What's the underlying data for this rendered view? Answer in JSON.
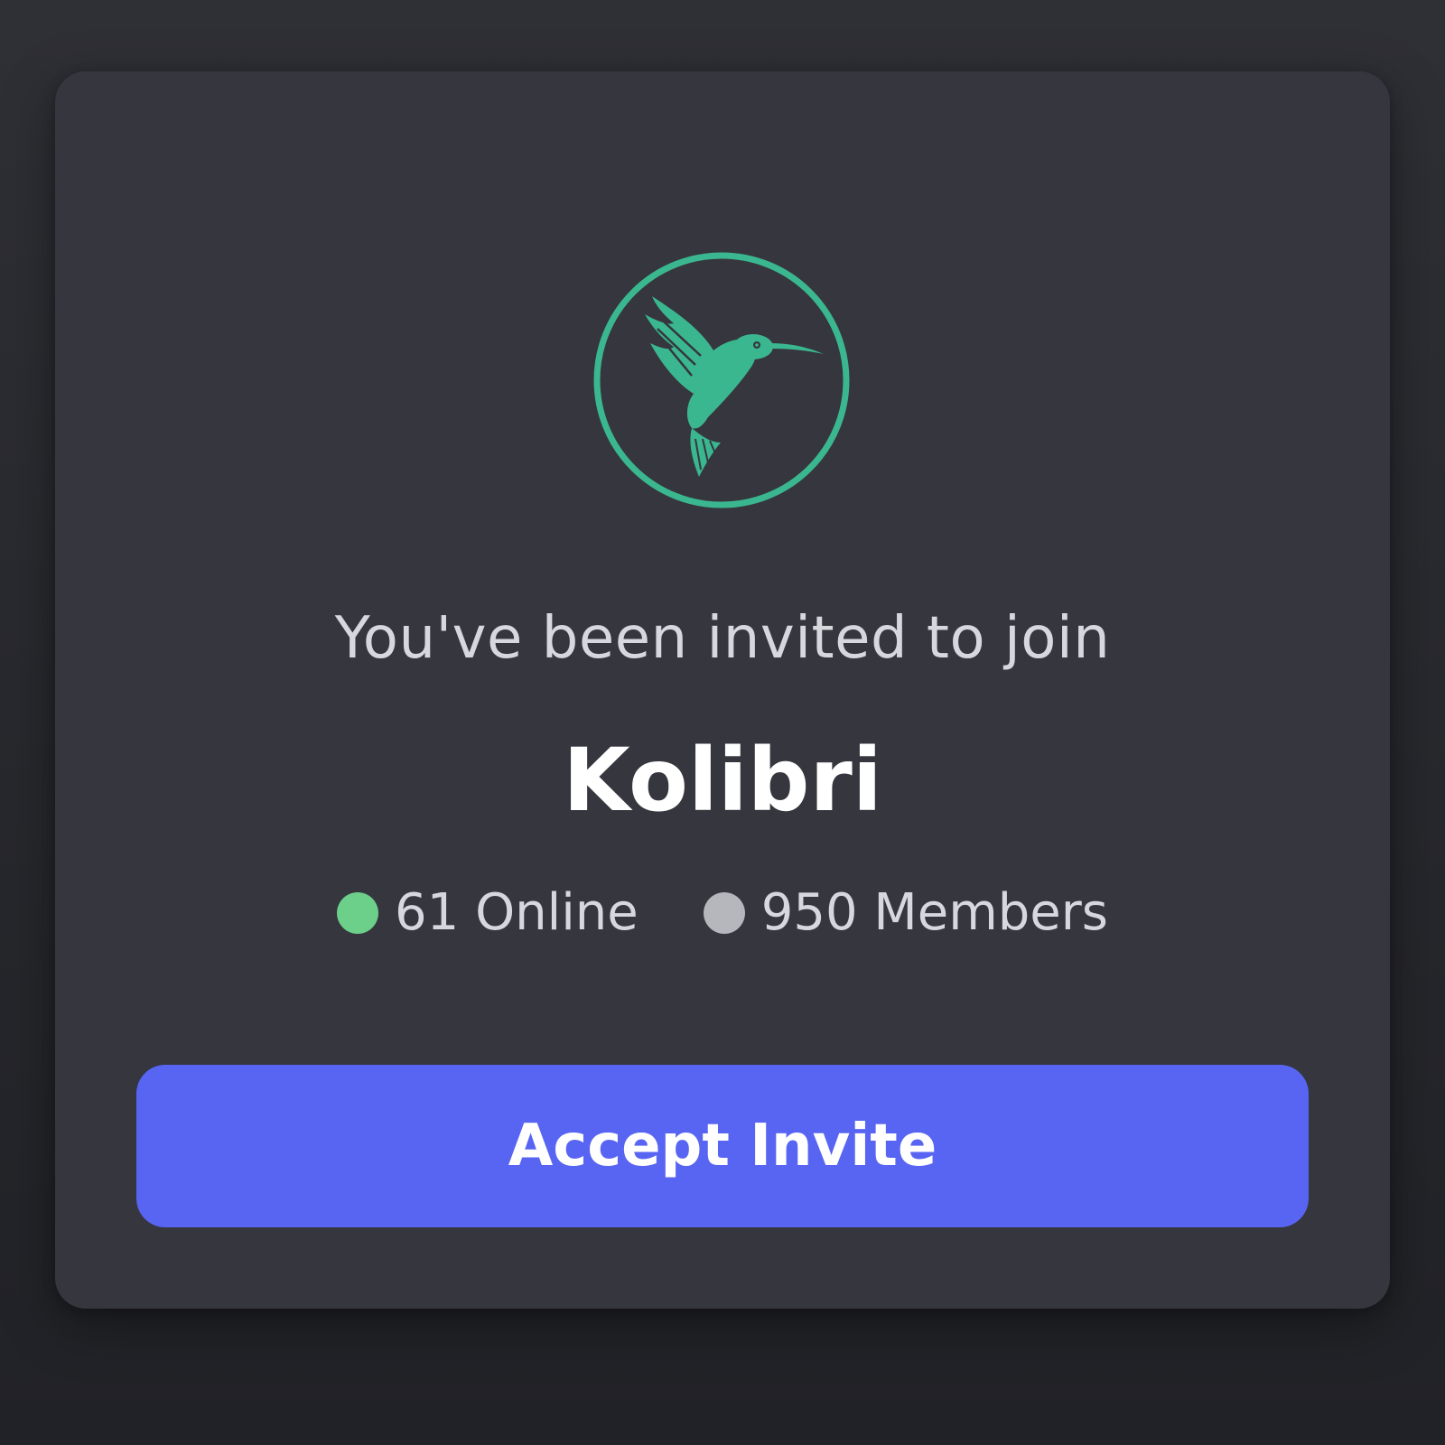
{
  "invite": {
    "heading": "You've been invited to join",
    "server_name": "Kolibri",
    "online_label": "61 Online",
    "members_label": "950 Members",
    "accept_label": "Accept Invite"
  },
  "server_icon": {
    "name": "hummingbird-logo-icon",
    "accent": "#3bb78f"
  },
  "colors": {
    "page_background": "#2b2c31",
    "card_background": "#35363e",
    "online_dot": "#6ccf8a",
    "members_dot": "#b6b7bd",
    "button": "#5865f2",
    "button_text": "#ffffff",
    "heading_text": "#d7d8de",
    "title_text": "#ffffff"
  }
}
